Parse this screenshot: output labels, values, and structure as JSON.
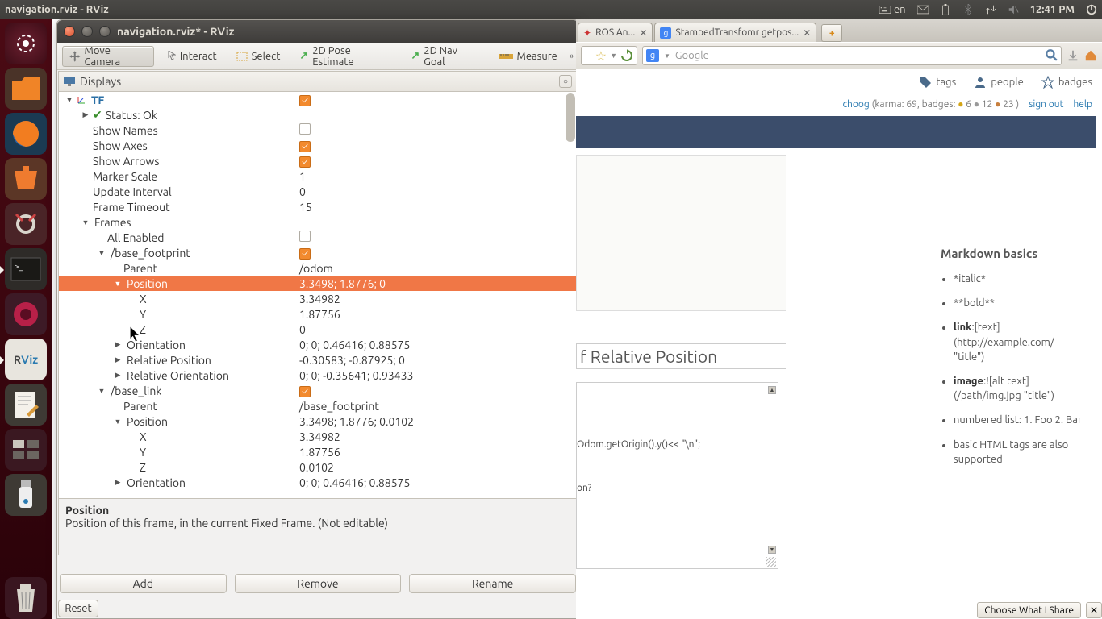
{
  "topbar": {
    "title": "navigation.rviz - RViz",
    "lang": "en",
    "time": "12:41 PM"
  },
  "rviz": {
    "title": "navigation.rviz* - RViz",
    "toolbar": {
      "move": "Move Camera",
      "interact": "Interact",
      "select": "Select",
      "pose": "2D Pose Estimate",
      "goal": "2D Nav Goal",
      "measure": "Measure"
    },
    "panel": "Displays",
    "info_title": "Position",
    "info_body": "Position of this frame, in the current Fixed Frame. (Not editable)",
    "buttons": {
      "add": "Add",
      "remove": "Remove",
      "rename": "Rename",
      "reset": "Reset"
    },
    "tree": {
      "tf": "TF",
      "status": "Status: Ok",
      "showNames": "Show Names",
      "showAxes": "Show Axes",
      "showArrows": "Show Arrows",
      "markerScale_k": "Marker Scale",
      "markerScale_v": "1",
      "updateInt_k": "Update Interval",
      "updateInt_v": "0",
      "frameTimeout_k": "Frame Timeout",
      "frameTimeout_v": "15",
      "frames": "Frames",
      "allEnabled": "All Enabled",
      "bf": "/base_footprint",
      "bf_parent_k": "Parent",
      "bf_parent_v": "/odom",
      "bf_pos_k": "Position",
      "bf_pos_v": "3.3498; 1.8776; 0",
      "bf_x_k": "X",
      "bf_x_v": "3.34982",
      "bf_y_k": "Y",
      "bf_y_v": "1.87756",
      "bf_z_k": "Z",
      "bf_z_v": "0",
      "bf_ori_k": "Orientation",
      "bf_ori_v": "0; 0; 0.46416; 0.88575",
      "bf_rp_k": "Relative Position",
      "bf_rp_v": "-0.30583; -0.87925; 0",
      "bf_ro_k": "Relative Orientation",
      "bf_ro_v": "0; 0; -0.35641; 0.93433",
      "bl": "/base_link",
      "bl_parent_k": "Parent",
      "bl_parent_v": "/base_footprint",
      "bl_pos_k": "Position",
      "bl_pos_v": "3.3498; 1.8776; 0.0102",
      "bl_x_k": "X",
      "bl_x_v": "3.34982",
      "bl_y_k": "Y",
      "bl_y_v": "1.87756",
      "bl_z_k": "Z",
      "bl_z_v": "0.0102",
      "bl_ori_k": "Orientation",
      "bl_ori_v": "0; 0; 0.46416; 0.88575"
    }
  },
  "browser": {
    "tabs": {
      "t1": "ROS An...",
      "t2": "StampedTransfomr getpos..."
    },
    "search_placeholder": "Google",
    "nav": {
      "tags": "tags",
      "people": "people",
      "badges": "badges"
    },
    "karma": {
      "user": "choog",
      "text": "(karma: 69, badges: ",
      "g": "6",
      "s": "12",
      "b": "23",
      "signout": "sign out",
      "help": "help"
    },
    "qtitle": "f Relative Position",
    "edit_l1": "Odom.getOrigin().y()<< \"\\n\";",
    "edit_l2": "on?",
    "side_title": "Markdown basics",
    "side": {
      "italic": "*italic*",
      "bold": "**bold**",
      "link": "link:[text](http://example.com/ \"title\")",
      "image": "image:![alt text](/path/img.jpg \"title\")",
      "list": "numbered list: 1. Foo 2. Bar",
      "html": "basic HTML tags are also supported"
    },
    "share": "Choose What I Share"
  }
}
